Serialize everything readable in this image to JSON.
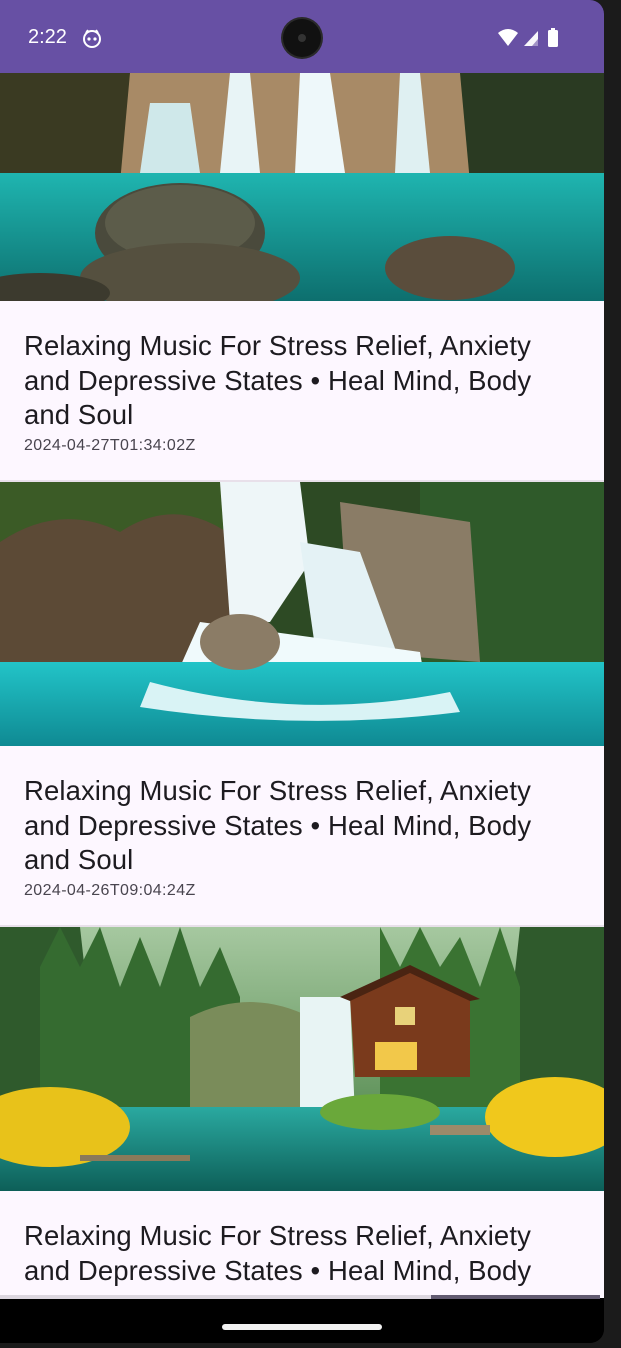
{
  "status_bar": {
    "time": "2:22",
    "background": "#6750a4",
    "icons": [
      "notification-face-icon",
      "wifi-icon",
      "cellular-signal-icon",
      "battery-icon"
    ]
  },
  "feed": {
    "items": [
      {
        "title": "Relaxing Music For Stress Relief, Anxiety and Depressive States • Heal Mind, Body and Soul",
        "published": "2024-04-27T01:34:02Z",
        "thumbnail": "waterfall-boulders-turquoise-pool"
      },
      {
        "title": "Relaxing Music For Stress Relief, Anxiety and Depressive States • Heal Mind, Body and Soul",
        "published": "2024-04-26T09:04:24Z",
        "thumbnail": "jungle-waterfall-turquoise-pool"
      },
      {
        "title": "Relaxing Music For Stress Relief, Anxiety and Depressive States • Heal Mind, Body",
        "thumbnail": "forest-cabin-waterfall-yellow-flowers"
      }
    ]
  },
  "colors": {
    "surface": "#fdf7ff",
    "title_text": "#1d1b20",
    "date_text": "#49454f",
    "scroll_thumb": "#625b71"
  }
}
